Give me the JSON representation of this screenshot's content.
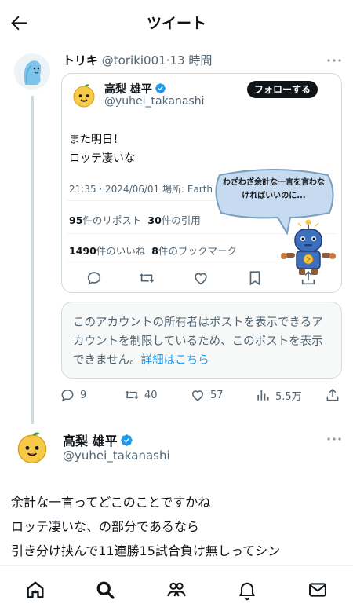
{
  "header": {
    "title": "ツイート"
  },
  "tweet1": {
    "name": "トリキ",
    "handle": "@toriki001",
    "dot": "·",
    "time": "13 時間",
    "quote": {
      "name": "高梨 雄平",
      "handle": "@yuhei_takanashi",
      "follow_label": "フォローする",
      "text": "また明日！\nロッテ凄いな",
      "meta": "21:35 · 2024/06/01 場所: Earth ·",
      "reposts_count": "95",
      "reposts_label": "件のリポスト",
      "quotes_count": "30",
      "quotes_label": "件の引用",
      "likes_count": "1490",
      "likes_label": "件のいいね",
      "bookmarks_count": "8",
      "bookmarks_label": "件のブックマーク",
      "bubble_text": "わざわざ余計な一言を言わなければいいのに..."
    },
    "notice_text": "このアカウントの所有者はポストを表示できるアカウントを制限しているため、このポストを表示できません。",
    "notice_link": "詳細はこちら",
    "stats": {
      "replies": "9",
      "retweets": "40",
      "likes": "57",
      "views": "5.5万"
    }
  },
  "tweet2": {
    "name": "高梨 雄平",
    "handle": "@yuhei_takanashi",
    "body": "余計な一言ってどこのことですかね\nロッテ凄いな、の部分であるなら\n引き分け挟んで11連勝15試合負け無しってシン"
  },
  "colors": {
    "accent": "#1d9bf0",
    "text": "#0f1419",
    "secondary": "#536471",
    "border": "#cfd9de"
  },
  "icons": [
    "back-arrow-icon",
    "verified-icon",
    "reply-icon",
    "retweet-icon",
    "like-icon",
    "bookmark-icon",
    "share-icon",
    "views-icon",
    "home-icon",
    "search-icon",
    "communities-icon",
    "notifications-icon",
    "messages-icon"
  ]
}
